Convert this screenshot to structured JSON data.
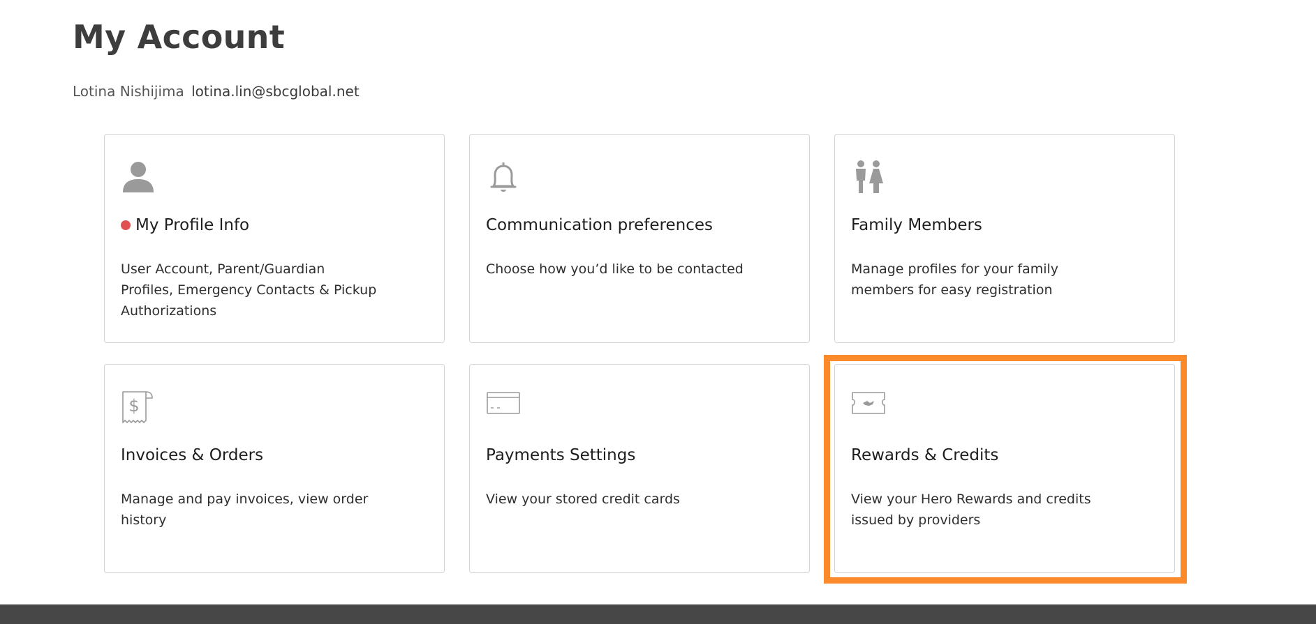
{
  "page": {
    "title": "My Account",
    "user_name": "Lotina Nishijima",
    "user_email": "lotina.lin@sbcglobal.net"
  },
  "cards": [
    {
      "icon": "person-icon",
      "title": "My Profile Info",
      "description": "User Account, Parent/Guardian Profiles, Emergency Contacts & Pickup Authorizations",
      "alert": true
    },
    {
      "icon": "bell-icon",
      "title": "Communication preferences",
      "description": "Choose how you’d like to be contacted"
    },
    {
      "icon": "family-icon",
      "title": "Family Members",
      "description": "Manage profiles for your family members for easy registration"
    },
    {
      "icon": "receipt-icon",
      "title": "Invoices & Orders",
      "description": "Manage and pay invoices, view order history"
    },
    {
      "icon": "credit-card-icon",
      "title": "Payments Settings",
      "description": "View your stored credit cards"
    },
    {
      "icon": "ticket-icon",
      "title": "Rewards & Credits",
      "description": "View your Hero Rewards and credits issued by providers",
      "highlighted": true
    }
  ],
  "colors": {
    "icon_gray": "#9a9a9a",
    "alert_dot": "#e05252",
    "highlight": "#fb8a2d",
    "footer": "#474747"
  }
}
